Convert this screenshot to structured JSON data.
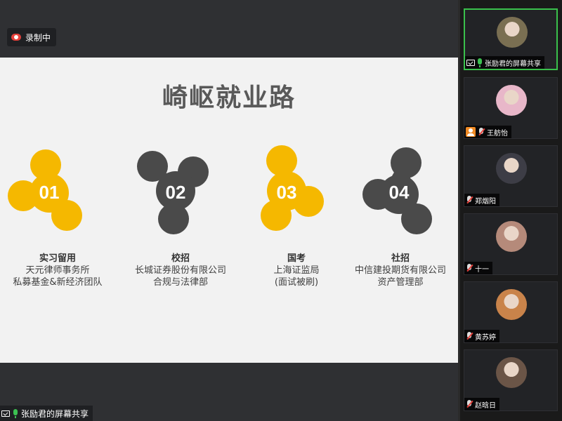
{
  "recording": {
    "label": "录制中",
    "icon": "recording-icon"
  },
  "slide": {
    "title": "崎岖就业路",
    "steps": [
      {
        "num": "01",
        "heading": "实习留用",
        "line1": "天元律师事务所",
        "line2": "私募基金&新经济团队",
        "color": "#f5b800"
      },
      {
        "num": "02",
        "heading": "校招",
        "line1": "长城证券股份有限公司",
        "line2": "合规与法律部",
        "color": "#4a4a4a"
      },
      {
        "num": "03",
        "heading": "国考",
        "line1": "上海证监局",
        "line2": "(面试被刷)",
        "color": "#f5b800"
      },
      {
        "num": "04",
        "heading": "社招",
        "line1": "中信建投期货有限公司",
        "line2": "资产管理部",
        "color": "#4a4a4a"
      }
    ]
  },
  "share_label": "张励君的屏幕共享",
  "participants": [
    {
      "name": "张励君的屏幕共享",
      "status": "screen-share",
      "avatar_color": "#7a6f52"
    },
    {
      "name": "王舫怡",
      "status": "muted-user",
      "avatar_color": "#e8b7c9"
    },
    {
      "name": "郑烟阳",
      "status": "muted",
      "avatar_color": "#3d3d46"
    },
    {
      "name": "十一",
      "status": "muted",
      "avatar_color": "#b58a7a"
    },
    {
      "name": "黄苏婷",
      "status": "muted",
      "avatar_color": "#c9834a"
    },
    {
      "name": "赵晗日",
      "status": "muted",
      "avatar_color": "#6b5547"
    }
  ]
}
